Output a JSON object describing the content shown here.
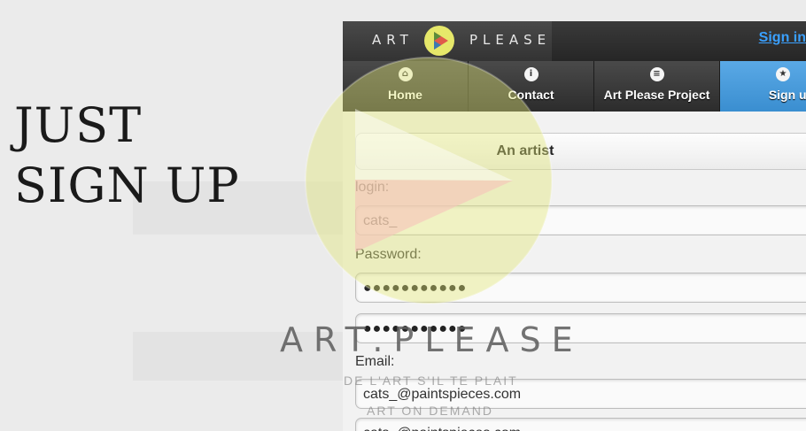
{
  "headline": {
    "line1": "JUST",
    "line2": "SIGN UP"
  },
  "brand": {
    "left": "ART",
    "right": "PLEASE",
    "logo": "art-please-play-logo-icon"
  },
  "header": {
    "signin_label": "Sign in"
  },
  "nav": [
    {
      "label": "Home",
      "icon": "home-icon",
      "glyph": "⌂"
    },
    {
      "label": "Contact",
      "icon": "info-icon",
      "glyph": "i"
    },
    {
      "label": "Art Please Project",
      "icon": "menu-icon",
      "glyph": "≡"
    },
    {
      "label": "Sign up",
      "icon": "star-icon",
      "glyph": "★"
    }
  ],
  "form": {
    "role_button": "An artist",
    "login_label": "login:",
    "login_value": "cats_",
    "password_label": "Password:",
    "password_mask": "●●●●●●●●●●●",
    "password_confirm_mask": "●●●●●●●●●●●",
    "email_label": "Email:",
    "email_value": "cats_@paintspieces.com",
    "email_confirm_value": "cats_@paintspieces.com"
  },
  "watermark": {
    "title": "ART.PLEASE",
    "sub1": "DE L'ART S'IL TE PLAIT",
    "sub2": "ART ON DEMAND"
  },
  "colors": {
    "accent": "#3a8ed0",
    "link": "#3aa0ff",
    "logo_yellow": "#e6e86a",
    "logo_red": "#e05a4a"
  }
}
